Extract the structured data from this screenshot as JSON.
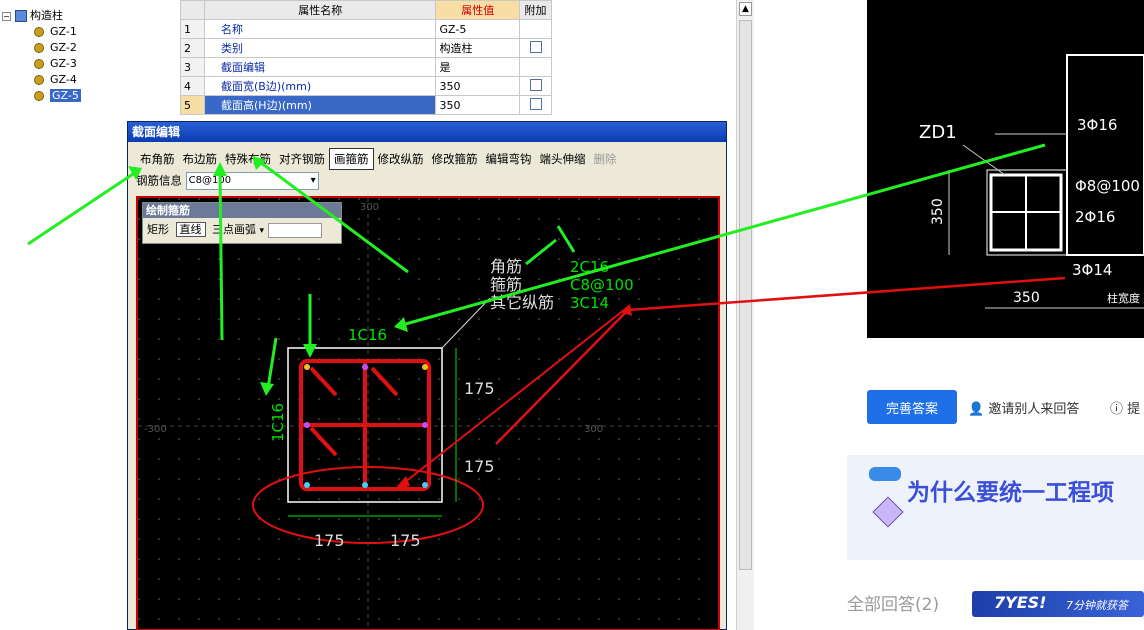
{
  "tree": {
    "root_label": "构造柱",
    "items": [
      "GZ-1",
      "GZ-2",
      "GZ-3",
      "GZ-4",
      "GZ-5"
    ],
    "selected": "GZ-5"
  },
  "property_grid": {
    "headers": {
      "name": "属性名称",
      "value": "属性值",
      "extra": "附加"
    },
    "rows": [
      {
        "num": "1",
        "name": "名称",
        "value": "GZ-5",
        "checkbox": false
      },
      {
        "num": "2",
        "name": "类别",
        "value": "构造柱",
        "checkbox": true
      },
      {
        "num": "3",
        "name": "截面编辑",
        "value": "是",
        "checkbox": false
      },
      {
        "num": "4",
        "name": "截面宽(B边)(mm)",
        "value": "350",
        "checkbox": true
      },
      {
        "num": "5",
        "name": "截面高(H边)(mm)",
        "value": "350",
        "checkbox": true
      }
    ]
  },
  "dialog": {
    "title": "截面编辑",
    "toolbar": [
      "布角筋",
      "布边筋",
      "特殊布筋",
      "对齐钢筋",
      "画箍筋",
      "修改纵筋",
      "修改箍筋",
      "编辑弯钩",
      "端头伸缩",
      "删除"
    ],
    "active_tool": "画箍筋",
    "disabled_tool": "删除",
    "rebar_label": "钢筋信息",
    "rebar_value": "C8@100",
    "palette": {
      "title": "绘制箍筋",
      "mode1": "矩形",
      "mode2": "直线",
      "mode3": "三点画弧"
    },
    "annotations": {
      "corner_label": "角筋",
      "stirrup_label": "箍筋",
      "other_label": "其它纵筋",
      "corner_value": "2C16",
      "stirrup_value": "C8@100",
      "other_value": "3C14",
      "top_edge": "1C16",
      "left_edge": "1C16",
      "dim_h1": "175",
      "dim_h2": "175",
      "dim_w1": "175",
      "dim_w2": "175",
      "ruler_left": "-300",
      "ruler_right": "300",
      "ruler_top": "300"
    }
  },
  "cad": {
    "zd_label": "ZD1",
    "top_bar": "3Φ16",
    "stirrup": "Φ8@100",
    "side_bar": "2Φ16",
    "bottom_bar": "3Φ14",
    "dim_v": "350",
    "dim_h": "350",
    "dim_label": "柱宽度"
  },
  "qa": {
    "answer_button": "完善答案",
    "invite": "邀请别人来回答",
    "tips": "提",
    "banner_text": "为什么要统一工程项",
    "all_answers": "全部回答(2)",
    "yes_badge": "7YES!",
    "yes_text": "7分钟就获答"
  },
  "colors": {
    "accent": "#1e6fe8",
    "cad_bg": "#000000",
    "rebar_red": "#e01010",
    "annotation_green": "#00e000",
    "arrow_green": "#22ee22"
  }
}
